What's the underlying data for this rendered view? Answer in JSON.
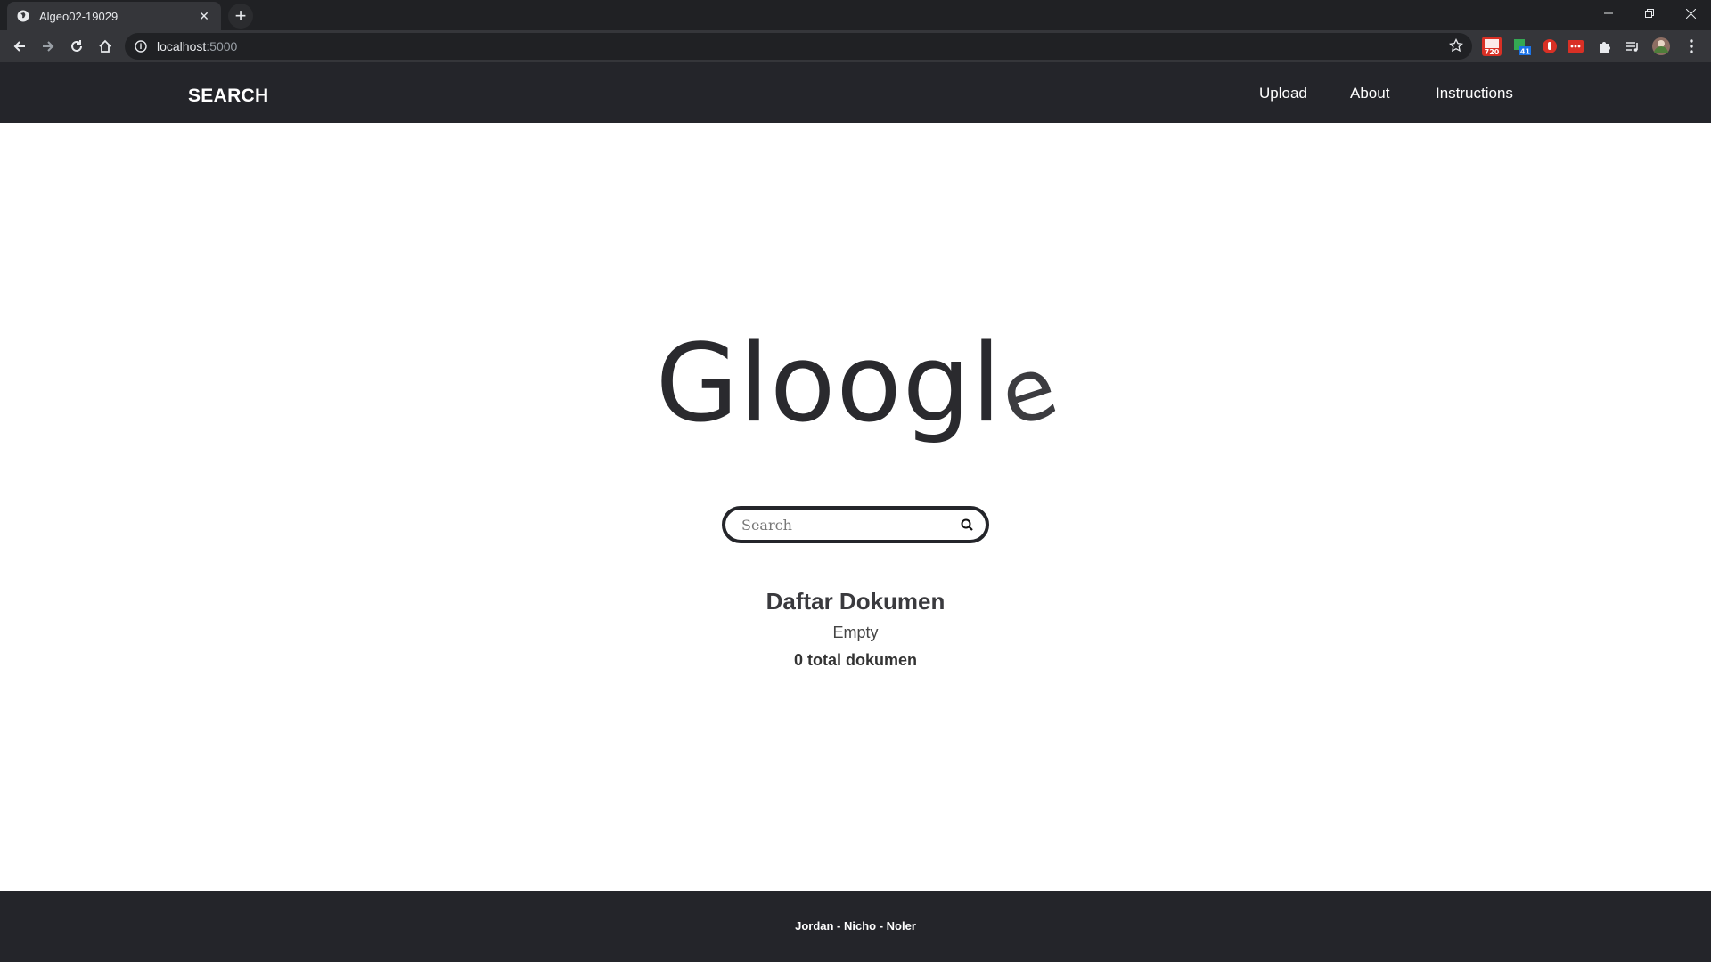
{
  "browser": {
    "tab_title": "Algeo02-19029",
    "tab_close": "✕",
    "new_tab": "+",
    "url_host": "localhost",
    "url_port": ":5000",
    "window_controls": [
      "minimize",
      "restore",
      "close"
    ],
    "extensions": [
      {
        "name": "extension-720-badge",
        "badge": "720",
        "color": "#d93025"
      },
      {
        "name": "extension-41-badge",
        "badge": "41",
        "color": "#1a73e8"
      },
      {
        "name": "extension-red-hand",
        "badge": "",
        "color": "#d93025"
      },
      {
        "name": "extension-red-dots",
        "badge": "•••",
        "color": "#d93025"
      }
    ]
  },
  "navbar": {
    "brand": "SEARCH",
    "links": [
      "Upload",
      "About",
      "Instructions"
    ]
  },
  "main": {
    "logo_text": "Gloogl",
    "logo_last_letter": "e",
    "search_placeholder": "Search",
    "list_heading": "Daftar Dokumen",
    "list_empty": "Empty",
    "total_label": "0 total dokumen"
  },
  "footer": {
    "credits": "Jordan - Nicho - Noler"
  }
}
